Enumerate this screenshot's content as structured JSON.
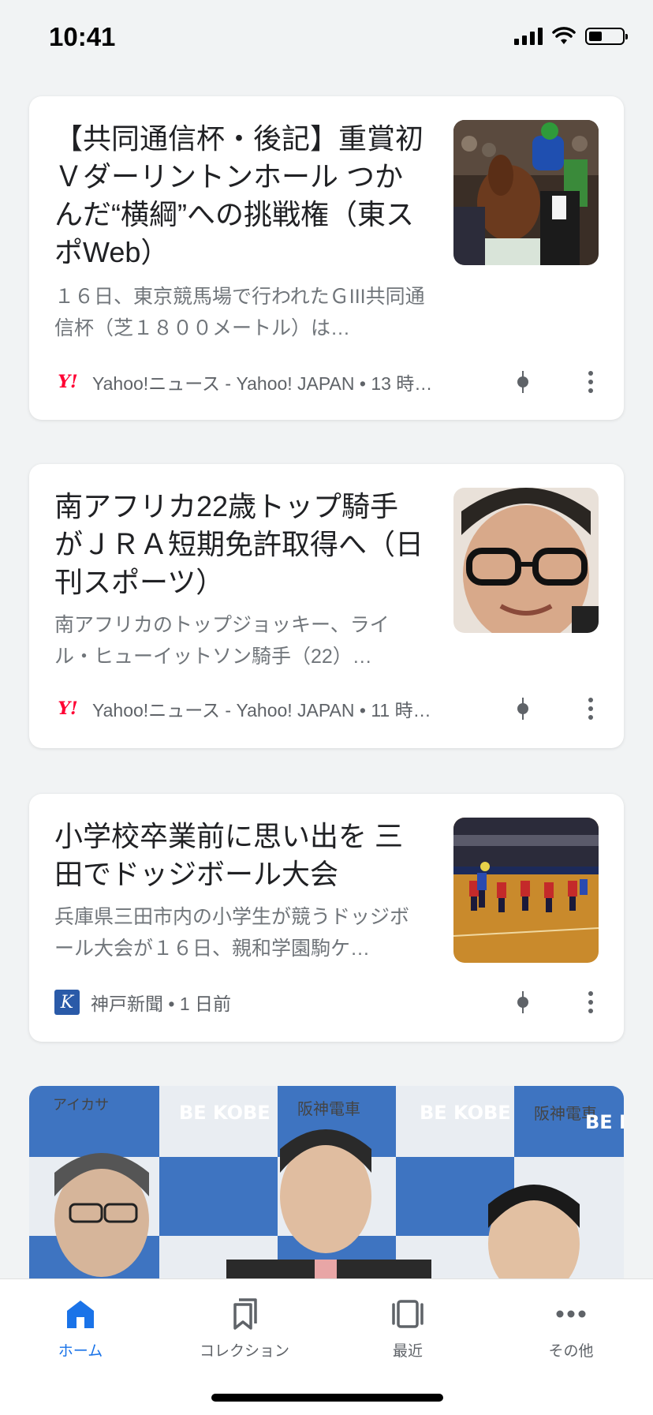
{
  "status_bar": {
    "time": "10:41"
  },
  "articles": [
    {
      "title": "【共同通信杯・後記】重賞初Ｖダーリントンホール つかんだ“横綱”への挑戦権（東スポWeb）",
      "snippet": "１６日、東京競馬場で行われたＧIII共同通信杯（芝１８００メートル）は…",
      "source": "Yahoo!ニュース - Yahoo! JAPAN • 13 時…",
      "logo": "Y!"
    },
    {
      "title": "南アフリカ22歳トップ騎手がＪＲＡ短期免許取得へ（日刊スポーツ）",
      "snippet": "南アフリカのトップジョッキー、ライル・ヒューイットソン騎手（22）…",
      "source": "Yahoo!ニュース - Yahoo! JAPAN • 11 時…",
      "logo": "Y!"
    },
    {
      "title": "小学校卒業前に思い出を 三田でドッジボール大会",
      "snippet": "兵庫県三田市内の小学生が競うドッジボール大会が１６日、親和学園駒ケ…",
      "source": "神戸新聞 • 1 日前",
      "logo": "K"
    }
  ],
  "hero": {
    "banner_texts": [
      "アイカサ",
      "BE KOBE",
      "阪神電車",
      "BE KOBE",
      "阪神電車",
      "BE K"
    ]
  },
  "bottom_nav": [
    {
      "label": "ホーム",
      "icon": "home-icon",
      "active": true
    },
    {
      "label": "コレクション",
      "icon": "bookmarks-icon",
      "active": false
    },
    {
      "label": "最近",
      "icon": "recent-icon",
      "active": false
    },
    {
      "label": "その他",
      "icon": "more-horiz-icon",
      "active": false
    }
  ],
  "colors": {
    "accent": "#1a73e8",
    "yahoo_red": "#ff0033",
    "kobe_blue": "#2a5aa8"
  }
}
